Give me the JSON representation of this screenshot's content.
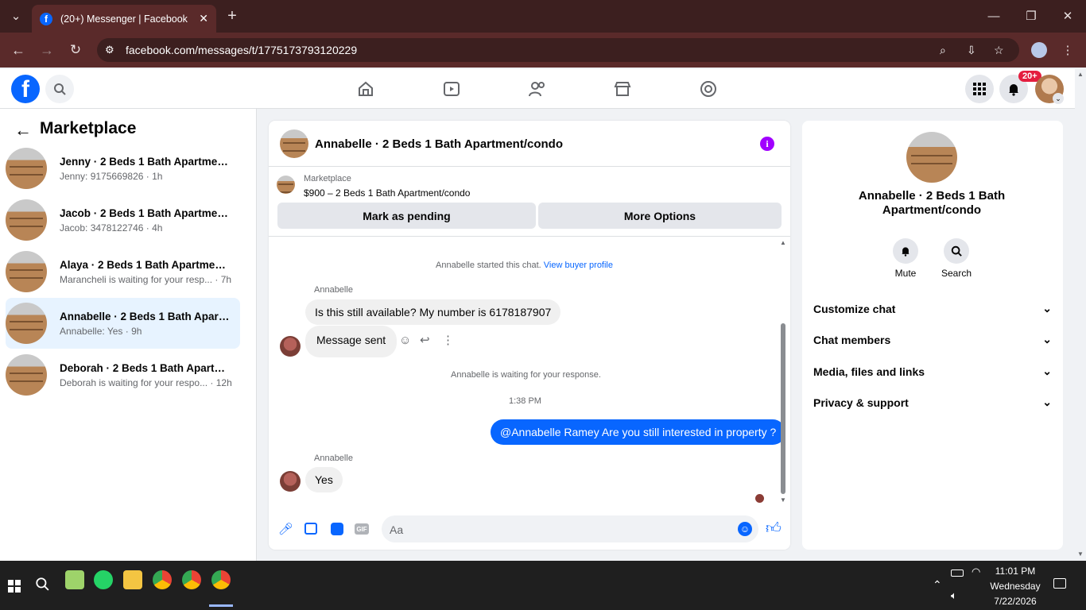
{
  "browser": {
    "tab_title": "(20+) Messenger | Facebook",
    "url": "facebook.com/messages/t/1775173793120229"
  },
  "fbnav": {
    "notification_badge": "20+"
  },
  "sidebar": {
    "title": "Marketplace",
    "conversations": [
      {
        "title": "Jenny · 2 Beds 1 Bath Apartment...",
        "sub": "Jenny: 9175669826 · 1h"
      },
      {
        "title": "Jacob · 2 Beds 1 Bath Apartment...",
        "sub": "Jacob: 3478122746 · 4h"
      },
      {
        "title": "Alaya · 2 Beds 1 Bath Apartment...",
        "sub": "Marancheli is waiting for your resp... · 7h"
      },
      {
        "title": "Annabelle · 2 Beds 1 Bath Apart...",
        "sub": "Annabelle: Yes · 9h"
      },
      {
        "title": "Deborah · 2 Beds 1 Bath Apartm...",
        "sub": "Deborah is waiting for your respo... · 12h"
      }
    ]
  },
  "chat": {
    "header_title": "Annabelle · 2 Beds 1 Bath Apartment/condo",
    "listing_source": "Marketplace",
    "listing_title": "$900 – 2 Beds 1 Bath Apartment/condo",
    "mark_pending_label": "Mark as pending",
    "more_options_label": "More Options",
    "started_text": "Annabelle started this chat.",
    "view_profile_link": "View buyer profile",
    "sender_name_1": "Annabelle",
    "msg1": "Is this still available? My number is 6178187907",
    "msg2": "Message sent",
    "waiting_text": "Annabelle is waiting for your response.",
    "timestamp": "1:38 PM",
    "outgoing_msg": "@Annabelle Ramey Are you still interested in property ?",
    "sender_name_2": "Annabelle",
    "msg3": "Yes",
    "composer_placeholder": "Aa",
    "accent_color": "#0866ff"
  },
  "info_panel": {
    "name": "Annabelle · 2 Beds 1 Bath Apartment/condo",
    "mute_label": "Mute",
    "search_label": "Search",
    "sections": [
      "Customize chat",
      "Chat members",
      "Media, files and links",
      "Privacy & support"
    ]
  },
  "taskbar": {
    "time": "11:01 PM",
    "day": "Wednesday",
    "date": "7/22/2026"
  }
}
